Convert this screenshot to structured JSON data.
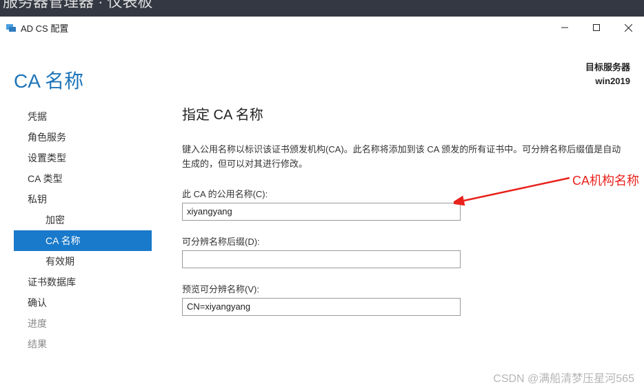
{
  "topbar_partial": "服务器管理器 · 仪表板",
  "window": {
    "title": "AD CS 配置"
  },
  "header": {
    "page_title": "CA 名称",
    "target_label": "目标服务器",
    "target_value": "win2019"
  },
  "sidebar": {
    "items": [
      {
        "label": "凭据",
        "sub": false,
        "active": false,
        "disabled": false
      },
      {
        "label": "角色服务",
        "sub": false,
        "active": false,
        "disabled": false
      },
      {
        "label": "设置类型",
        "sub": false,
        "active": false,
        "disabled": false
      },
      {
        "label": "CA 类型",
        "sub": false,
        "active": false,
        "disabled": false
      },
      {
        "label": "私钥",
        "sub": false,
        "active": false,
        "disabled": false
      },
      {
        "label": "加密",
        "sub": true,
        "active": false,
        "disabled": false
      },
      {
        "label": "CA 名称",
        "sub": true,
        "active": true,
        "disabled": false
      },
      {
        "label": "有效期",
        "sub": true,
        "active": false,
        "disabled": false
      },
      {
        "label": "证书数据库",
        "sub": false,
        "active": false,
        "disabled": false
      },
      {
        "label": "确认",
        "sub": false,
        "active": false,
        "disabled": false
      },
      {
        "label": "进度",
        "sub": false,
        "active": false,
        "disabled": true
      },
      {
        "label": "结果",
        "sub": false,
        "active": false,
        "disabled": true
      }
    ]
  },
  "main": {
    "section_title": "指定 CA 名称",
    "description": "键入公用名称以标识该证书颁发机构(CA)。此名称将添加到该 CA 颁发的所有证书中。可分辨名称后缀值是自动生成的，但可以对其进行修改。",
    "common_name_label": "此 CA 的公用名称(C):",
    "common_name_value": "xiyangyang",
    "dn_suffix_label": "可分辨名称后缀(D):",
    "dn_suffix_value": "",
    "dn_preview_label": "预览可分辨名称(V):",
    "dn_preview_value": "CN=xiyangyang"
  },
  "annotation": {
    "text": "CA机构名称"
  },
  "watermark": "CSDN @满船清梦压星河565"
}
